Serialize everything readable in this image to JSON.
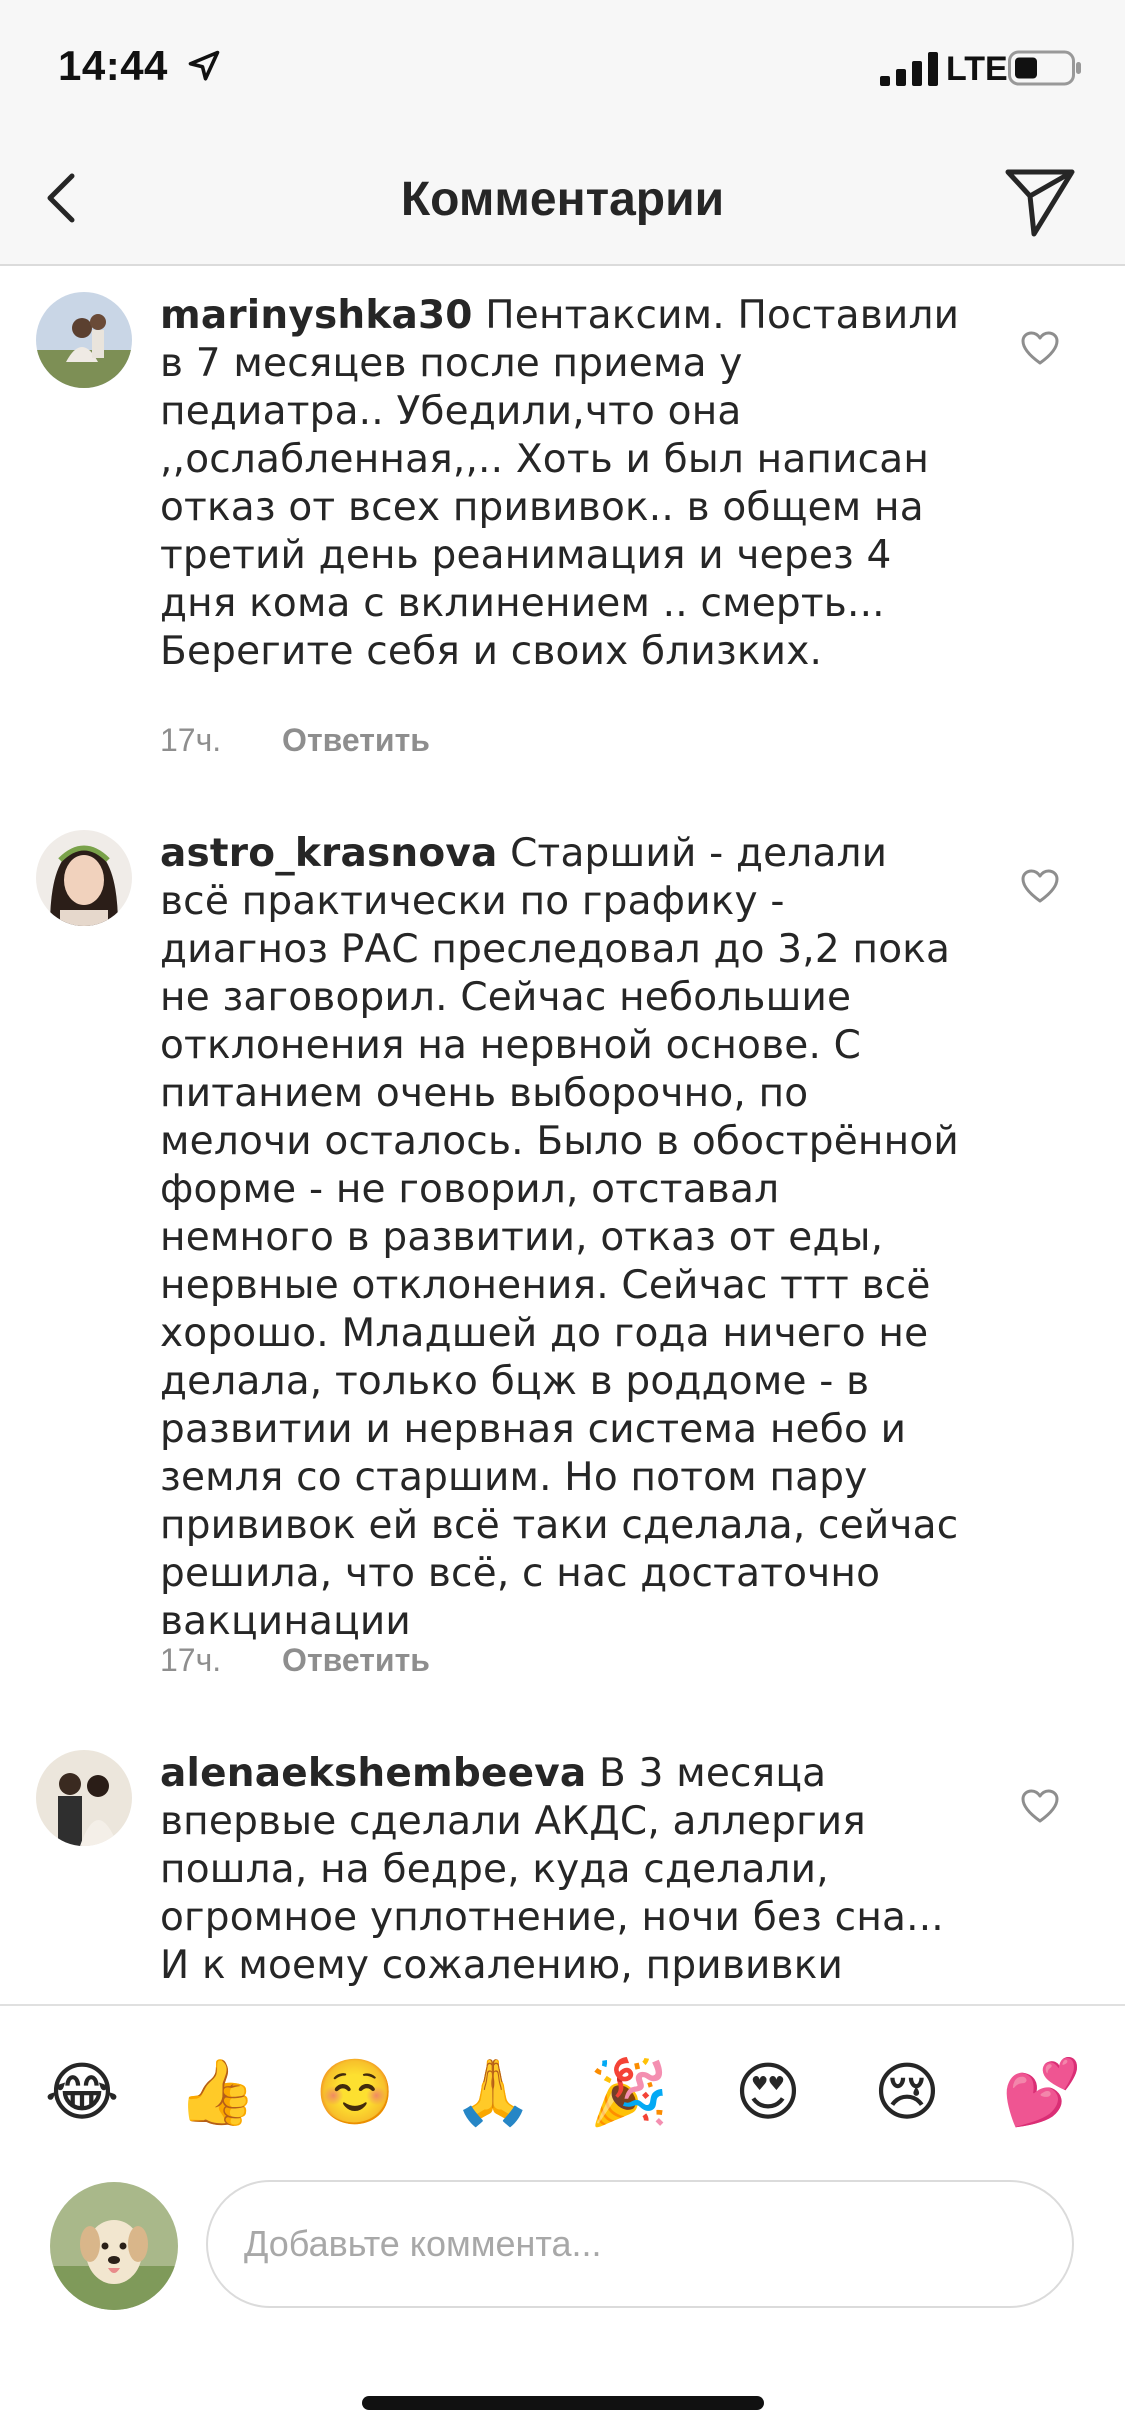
{
  "status_bar": {
    "time": "14:44",
    "network": "LTE",
    "icons": [
      "location-arrow-icon",
      "signal-bars-icon",
      "battery-icon"
    ]
  },
  "header": {
    "title": "Комментарии",
    "back_icon": "chevron-left-icon",
    "share_icon": "paper-plane-icon"
  },
  "comments": [
    {
      "username": "marinyshka30",
      "text": "Пентаксим. Поставили в 7 месяцев после приема у педиатра.. Убедили,что она ,,ослабленная,,.. Хоть и был написан отказ от всех прививок.. в общем на третий день реанимация и через 4 дня кома с вклинением .. смерть... Берегите себя и своих близких.",
      "time": "17ч.",
      "reply_label": "Ответить"
    },
    {
      "username": "astro_krasnova",
      "text": "Старший - делали всё практически по графику - диагноз РАС преследовал до 3,2 пока не заговорил. Сейчас небольшие отклонения на нервной основе. С питанием очень выборочно, по мелочи осталось. Было в обострённой форме - не говорил, отставал немного в развитии, отказ от еды, нервные отклонения. Сейчас ттт всё хорошо. Младшей до года ничего не делала, только бцж в роддоме - в развитии и нервная система небо и земля со старшим. Но потом пару прививок ей всё таки сделала, сейчас решила, что всё, с нас достаточно вакцинации",
      "time": "17ч.",
      "reply_label": "Ответить"
    },
    {
      "username": "alenaekshembeeva",
      "text": "В 3 месяца впервые сделали АКДС, аллергия пошла, на бедре, куда сделали, огромное уплотнение, ночи без сна... И к моему сожалению, прививки",
      "time": "",
      "reply_label": ""
    }
  ],
  "emoji_bar": [
    "😂",
    "👍",
    "☺️",
    "🙏",
    "🎉",
    "😍",
    "😢",
    "💕"
  ],
  "input": {
    "placeholder": "Добавьте коммента..."
  },
  "colors": {
    "bar_background": "#f7f7f7",
    "text": "#262626",
    "secondary_text": "#8e8e8e",
    "border": "#dbdbdb"
  }
}
